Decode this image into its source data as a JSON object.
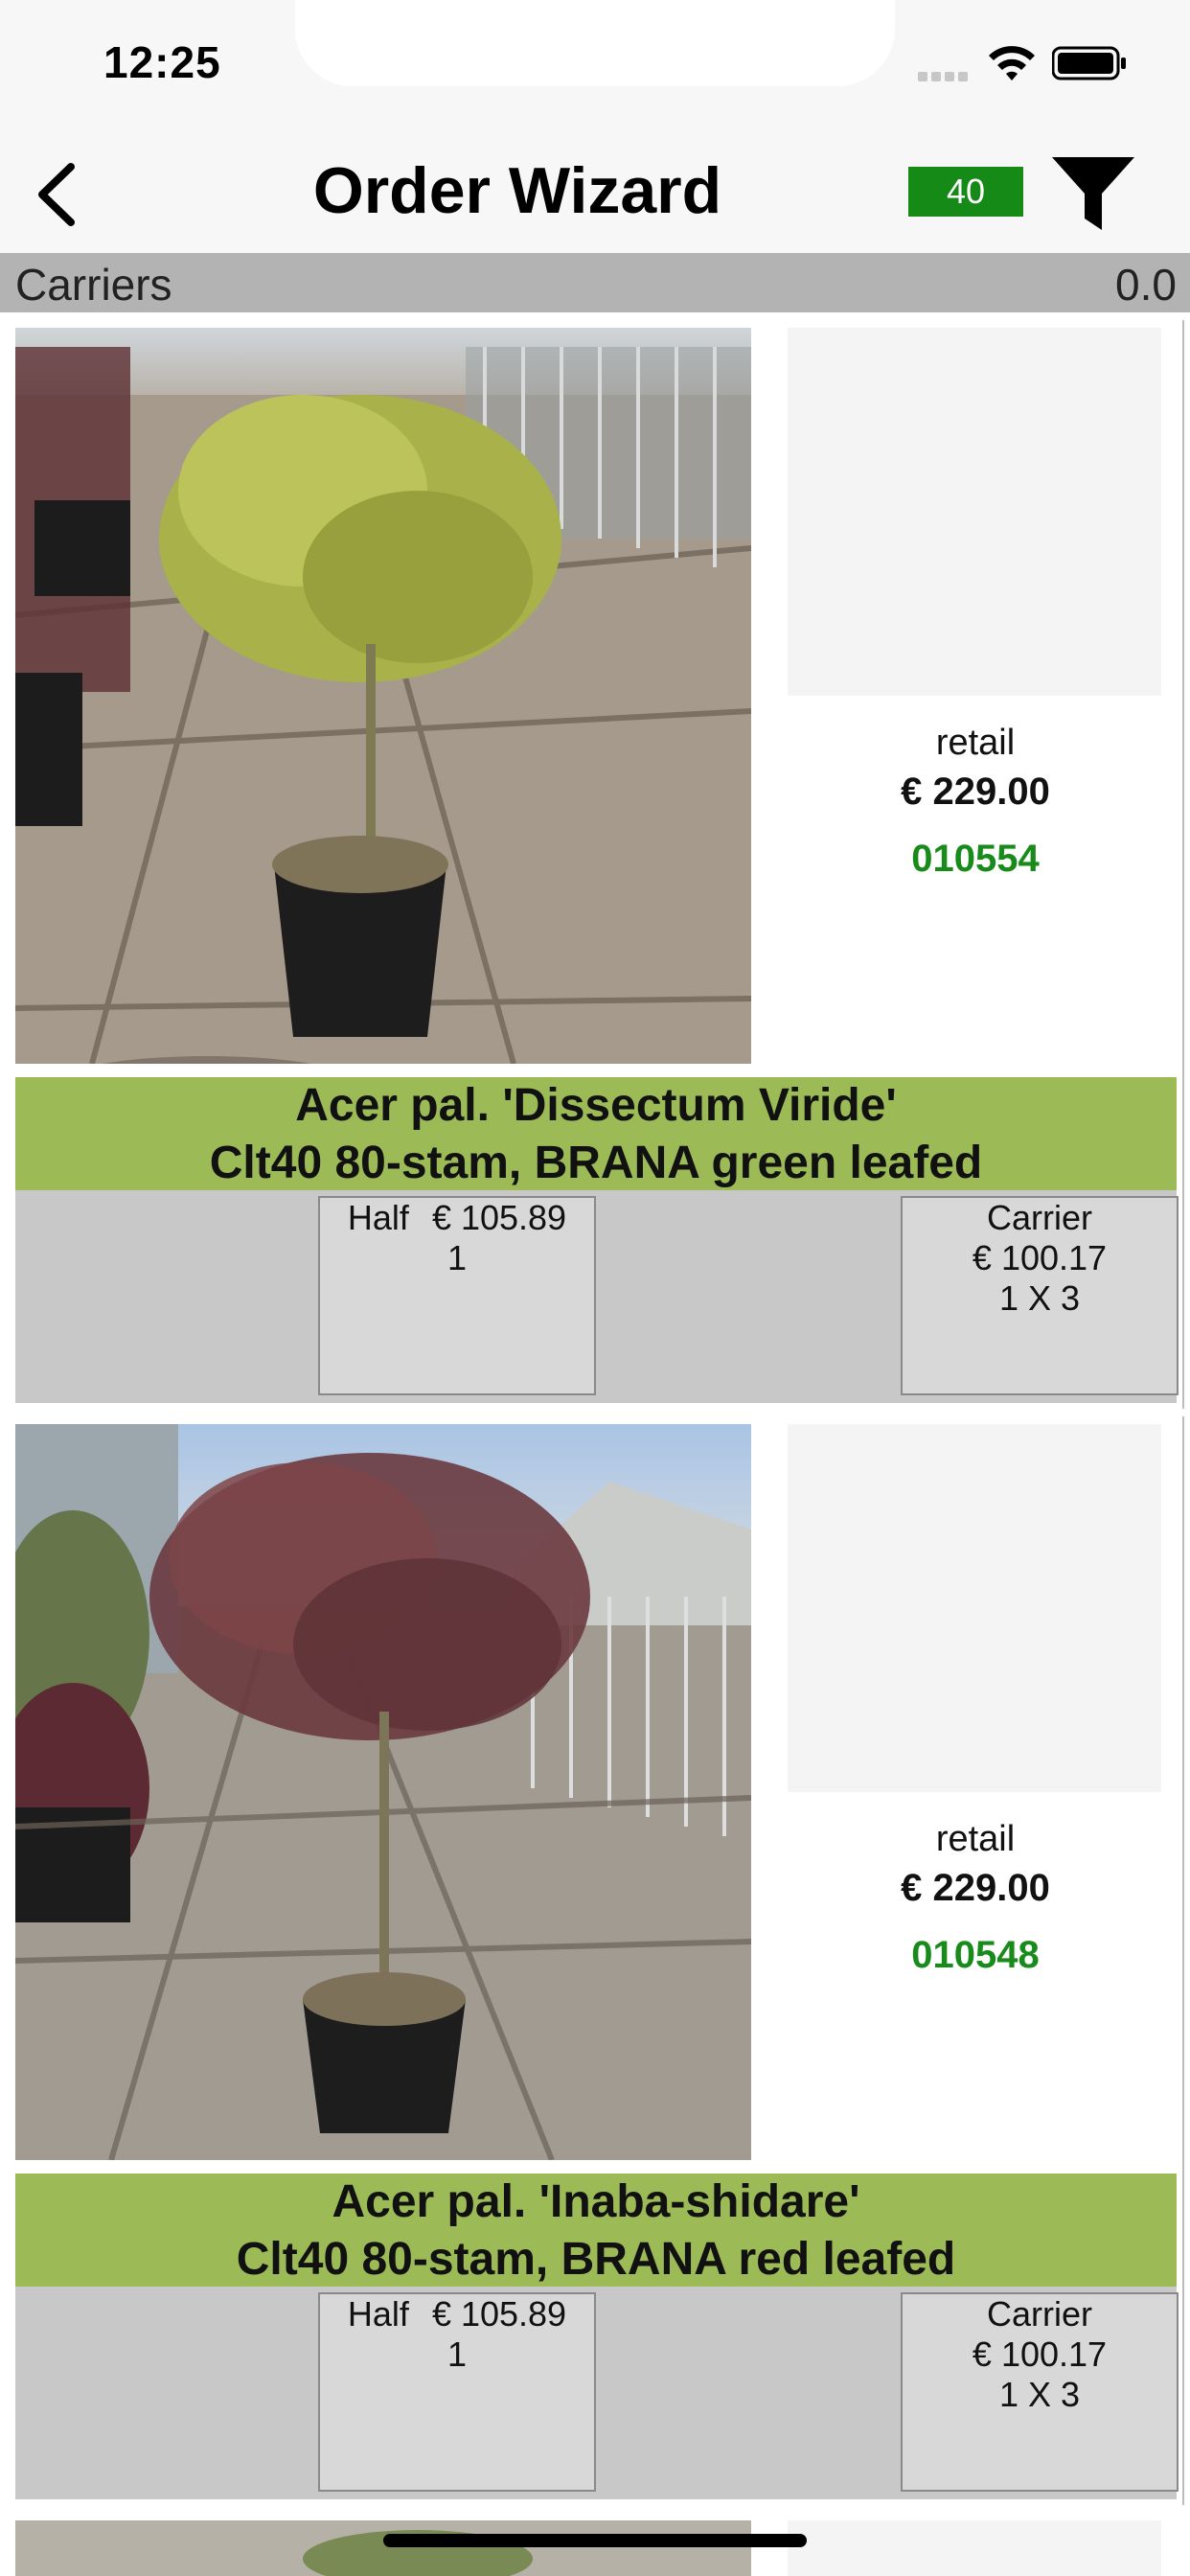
{
  "status_bar": {
    "time": "12:25"
  },
  "nav": {
    "title": "Order Wizard",
    "count": "40"
  },
  "carriers": {
    "label": "Carriers",
    "value": "0.0"
  },
  "products": [
    {
      "retail_label": "retail",
      "retail_price": "€ 229.00",
      "code": "010554",
      "name": "Acer pal. 'Dissectum Viride'",
      "spec": "Clt40 80-stam, BRANA green leafed",
      "half_label": "Half",
      "half_price": "€ 105.89",
      "half_qty": "1",
      "carrier_label": "Carrier",
      "carrier_price": "€ 100.17",
      "carrier_qty": "1 X 3"
    },
    {
      "retail_label": "retail",
      "retail_price": "€ 229.00",
      "code": "010548",
      "name": "Acer pal. 'Inaba-shidare'",
      "spec": "Clt40 80-stam, BRANA red leafed",
      "half_label": "Half",
      "half_price": "€ 105.89",
      "half_qty": "1",
      "carrier_label": "Carrier",
      "carrier_price": "€ 100.17",
      "carrier_qty": "1 X 3"
    }
  ]
}
